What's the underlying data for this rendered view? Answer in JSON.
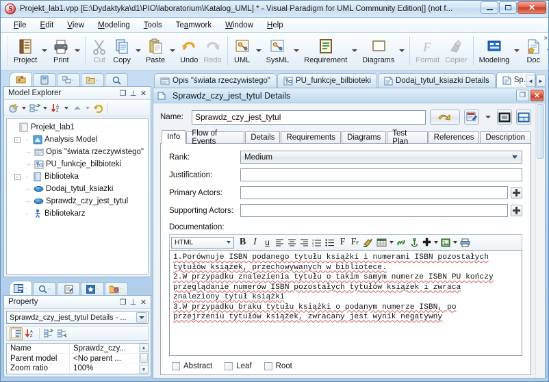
{
  "window": {
    "title": "Projekt_lab1.vpp [E:\\Dydaktyka\\d1\\PIO\\laboratorium\\Katalog_UML] * - Visual Paradigm for UML Community Edition[] (not f...",
    "minimize_label": "Minimize",
    "maximize_label": "Maximize",
    "close_label": "✕"
  },
  "menubar": {
    "items": [
      {
        "label": "File"
      },
      {
        "label": "Edit"
      },
      {
        "label": "View"
      },
      {
        "label": "Modeling"
      },
      {
        "label": "Tools"
      },
      {
        "label": "Teamwork"
      },
      {
        "label": "Window"
      },
      {
        "label": "Help"
      }
    ]
  },
  "toolbar": {
    "groups": [
      {
        "buttons": [
          {
            "label": "Project",
            "icon": "project-icon",
            "dropdown": true,
            "disabled": false
          },
          {
            "label": "Print",
            "icon": "print-icon",
            "dropdown": true,
            "disabled": false
          }
        ]
      },
      {
        "buttons": [
          {
            "label": "Cut",
            "icon": "scissors-icon",
            "dropdown": false,
            "disabled": true
          },
          {
            "label": "Copy",
            "icon": "copy-icon",
            "dropdown": true,
            "disabled": false
          },
          {
            "label": "Paste",
            "icon": "paste-icon",
            "dropdown": true,
            "disabled": false
          },
          {
            "label": "Undo",
            "icon": "undo-icon",
            "dropdown": false,
            "disabled": false
          },
          {
            "label": "Redo",
            "icon": "redo-icon",
            "dropdown": false,
            "disabled": true
          }
        ]
      },
      {
        "buttons": [
          {
            "label": "UML",
            "icon": "uml-icon",
            "dropdown": true,
            "disabled": false
          },
          {
            "label": "SysML",
            "icon": "sysml-icon",
            "dropdown": true,
            "disabled": false
          },
          {
            "label": "Requirement",
            "icon": "requirement-icon",
            "dropdown": true,
            "disabled": false
          },
          {
            "label": "Diagrams",
            "icon": "diagrams-icon",
            "dropdown": true,
            "disabled": false
          }
        ]
      },
      {
        "buttons": [
          {
            "label": "Format",
            "icon": "format-icon",
            "dropdown": false,
            "disabled": true
          },
          {
            "label": "Copier",
            "icon": "copier-icon",
            "dropdown": false,
            "disabled": true
          }
        ]
      },
      {
        "buttons": [
          {
            "label": "Modeling",
            "icon": "modeling-icon",
            "dropdown": true,
            "disabled": false
          },
          {
            "label": "Doc",
            "icon": "doc-icon",
            "dropdown": true,
            "disabled": false
          }
        ]
      }
    ],
    "overflow_label": "»"
  },
  "model_explorer": {
    "icon_tabs": [
      {
        "name": "model-explorer-tab",
        "icon": "yellow-folder-icon",
        "active": true
      },
      {
        "name": "class-repository-tab",
        "icon": "blue-book-icon",
        "active": false
      },
      {
        "name": "diagram-navigator-tab",
        "icon": "diagram-icon",
        "active": false
      },
      {
        "name": "model-structure-tab",
        "icon": "folder-tree-icon",
        "active": false
      },
      {
        "name": "search-tab",
        "icon": "magnifier-icon",
        "active": false
      }
    ],
    "title": "Model Explorer",
    "header_buttons": [
      {
        "name": "restore-button",
        "glyph": "❐"
      },
      {
        "name": "pin-button",
        "glyph": "⊥"
      },
      {
        "name": "close-button",
        "glyph": "✕"
      }
    ],
    "toolbar_buttons": [
      {
        "name": "new-model-element-button",
        "icon": "new-element-icon",
        "dropdown": true
      },
      {
        "name": "group-by-button",
        "icon": "group-icon",
        "dropdown": true
      },
      {
        "name": "sort-button",
        "icon": "sort-az-icon",
        "dropdown": true
      },
      {
        "name": "collapse-button",
        "icon": "up-chevron-icon",
        "dropdown": true
      },
      {
        "name": "refresh-button",
        "icon": "refresh-icon",
        "dropdown": false
      }
    ],
    "tree": [
      {
        "label": "Projekt_lab1",
        "depth": 0,
        "icon": "project-node-icon",
        "expander": ""
      },
      {
        "label": "Analysis Model",
        "depth": 1,
        "icon": "model-node-icon",
        "expander": "-"
      },
      {
        "label": "Opis \"świata rzeczywistego\"",
        "depth": 2,
        "icon": "document-node-icon",
        "expander": ""
      },
      {
        "label": "PU_funkcje_bilbioteki",
        "depth": 2,
        "icon": "usecase-diagram-icon",
        "expander": ""
      },
      {
        "label": "Biblioteka",
        "depth": 1,
        "icon": "package-node-icon",
        "expander": "-"
      },
      {
        "label": "Dodaj_tytul_ksiazki",
        "depth": 2,
        "icon": "usecase-oval-icon",
        "expander": ""
      },
      {
        "label": "Sprawdz_czy_jest_tytul",
        "depth": 2,
        "icon": "usecase-oval-icon",
        "expander": ""
      },
      {
        "label": "Bibliotekarz",
        "depth": 1,
        "icon": "actor-icon",
        "expander": ""
      }
    ]
  },
  "property_panel": {
    "icon_tabs": [
      {
        "name": "property-tab",
        "icon": "property-grid-icon",
        "active": true
      },
      {
        "name": "overview-tab",
        "icon": "magnifier-icon",
        "active": false
      },
      {
        "name": "documentation-tab",
        "icon": "pencil-doc-icon",
        "active": false
      },
      {
        "name": "diagram-tab",
        "icon": "star-icon",
        "active": false
      },
      {
        "name": "model-tab",
        "icon": "folder-shapes-icon",
        "active": false
      }
    ],
    "title": "Property",
    "header_buttons": [
      {
        "name": "restore-button",
        "glyph": "❐"
      },
      {
        "name": "pin-button",
        "glyph": "⊥"
      },
      {
        "name": "close-button",
        "glyph": "✕"
      }
    ],
    "selector_value": "Sprawdz_czy_jest_tytul Details - ...",
    "toolbar_buttons": [
      {
        "name": "categorized-button",
        "icon": "categorized-icon",
        "active": true
      },
      {
        "name": "sort-az-button",
        "icon": "sort-az-icon",
        "active": false
      },
      {
        "name": "expand-all-button",
        "icon": "expand-all-icon",
        "active": false
      },
      {
        "name": "collapse-all-button",
        "icon": "collapse-all-icon",
        "active": false
      }
    ],
    "rows": [
      {
        "key": "Name",
        "value": "Sprawdz_czy..."
      },
      {
        "key": "Parent model",
        "value": "<No parent ..."
      },
      {
        "key": "Zoom ratio",
        "value": "100%"
      }
    ]
  },
  "document_tabs": {
    "tabs": [
      {
        "label": "Opis \"świata rzeczywistego\"",
        "icon": "document-tab-icon",
        "active": false
      },
      {
        "label": "PU_funkcje_bilbioteki",
        "icon": "usecase-tab-icon",
        "active": false
      },
      {
        "label": "Dodaj_tytul_ksiazki Details",
        "icon": "details-tab-icon",
        "active": false
      },
      {
        "label": "Sp...",
        "icon": "details-tab-icon",
        "active": true
      }
    ],
    "nav_prev": "◄",
    "nav_next": "►"
  },
  "details_window": {
    "title": "Sprawdz_czy_jest_tytul Details",
    "restore_label": "❐",
    "close_label": "✕",
    "name_label": "Name:",
    "name_value": "Sprawdz_czy_jest_tytul",
    "name_placeholder": "",
    "action_buttons": [
      {
        "name": "open-specification-button",
        "icon": "yellow-arrow-icon"
      },
      {
        "name": "edit-button",
        "icon": "edit-pencil-icon",
        "dropdown": true
      },
      {
        "name": "fit-button",
        "icon": "fit-size-icon",
        "dropdown": false
      },
      {
        "name": "open-diagram-button",
        "icon": "open-diagram-icon",
        "dropdown": false
      }
    ],
    "tabs": [
      {
        "label": "Info",
        "active": true
      },
      {
        "label": "Flow of Events",
        "active": false
      },
      {
        "label": "Details",
        "active": false
      },
      {
        "label": "Requirements",
        "active": false
      },
      {
        "label": "Diagrams",
        "active": false
      },
      {
        "label": "Test Plan",
        "active": false
      },
      {
        "label": "References",
        "active": false
      },
      {
        "label": "Description",
        "active": false
      }
    ],
    "fields": {
      "rank_label": "Rank:",
      "rank_value": "Medium",
      "justification_label": "Justification:",
      "justification_value": "",
      "primary_actors_label": "Primary Actors:",
      "primary_actors_value": "",
      "supporting_actors_label": "Supporting Actors:",
      "supporting_actors_value": "",
      "documentation_label": "Documentation:"
    },
    "rte_toolbar": {
      "format_value": "HTML",
      "buttons": [
        {
          "name": "bold-button",
          "glyph": "B",
          "style": "bold-serif"
        },
        {
          "name": "italic-button",
          "glyph": "I",
          "style": "italic-serif"
        },
        {
          "name": "underline-button",
          "glyph": "u",
          "style": "underline"
        },
        {
          "name": "align-left-button",
          "glyph": "align-left-icon",
          "style": "icon"
        },
        {
          "name": "align-center-button",
          "glyph": "align-center-icon",
          "style": "icon"
        },
        {
          "name": "align-right-button",
          "glyph": "align-right-icon",
          "style": "icon"
        },
        {
          "name": "ordered-list-button",
          "glyph": "ordered-list-icon",
          "style": "icon"
        },
        {
          "name": "unordered-list-button",
          "glyph": "bullet-list-icon",
          "style": "icon"
        },
        {
          "name": "font-button",
          "glyph": "F",
          "style": "serif"
        },
        {
          "name": "font-size-button",
          "glyph": "Fғ",
          "style": "serif"
        },
        {
          "name": "text-color-button",
          "glyph": "paint-icon",
          "style": "icon"
        },
        {
          "name": "insert-table-button",
          "glyph": "table-icon",
          "style": "icon",
          "dropdown": true
        },
        {
          "name": "insert-link-button",
          "glyph": "link-icon",
          "style": "icon"
        },
        {
          "name": "insert-anchor-button",
          "glyph": "anchor-icon",
          "style": "icon"
        },
        {
          "name": "insert-element-button",
          "glyph": "plus-icon",
          "style": "icon",
          "dropdown": true
        },
        {
          "name": "insert-image-button",
          "glyph": "image-icon",
          "style": "icon",
          "dropdown": true
        },
        {
          "name": "print-button",
          "glyph": "printer-icon",
          "style": "icon"
        }
      ]
    },
    "documentation_lines": [
      "1.Porównuje ISBN podanego tytułu książki i numerami ISBN pozostałych",
      "tytułów książek, przechowywanych w bibliotece.",
      "2.W przypadku znalezienia tytułu o takim samym numerze ISBN PU kończy",
      "przeglądanie numerów ISBN pozostałych tytułów książek i zwraca",
      "znaleziony tytuł książki",
      "3.W przypadku braku tytułu książki o podanym numerze ISBN, po",
      "przejrzeniu tytułów książek, zwracany jest wynik negatywny"
    ],
    "checkboxes": [
      {
        "label": "Abstract",
        "checked": false
      },
      {
        "label": "Leaf",
        "checked": false
      },
      {
        "label": "Root",
        "checked": false
      }
    ]
  }
}
